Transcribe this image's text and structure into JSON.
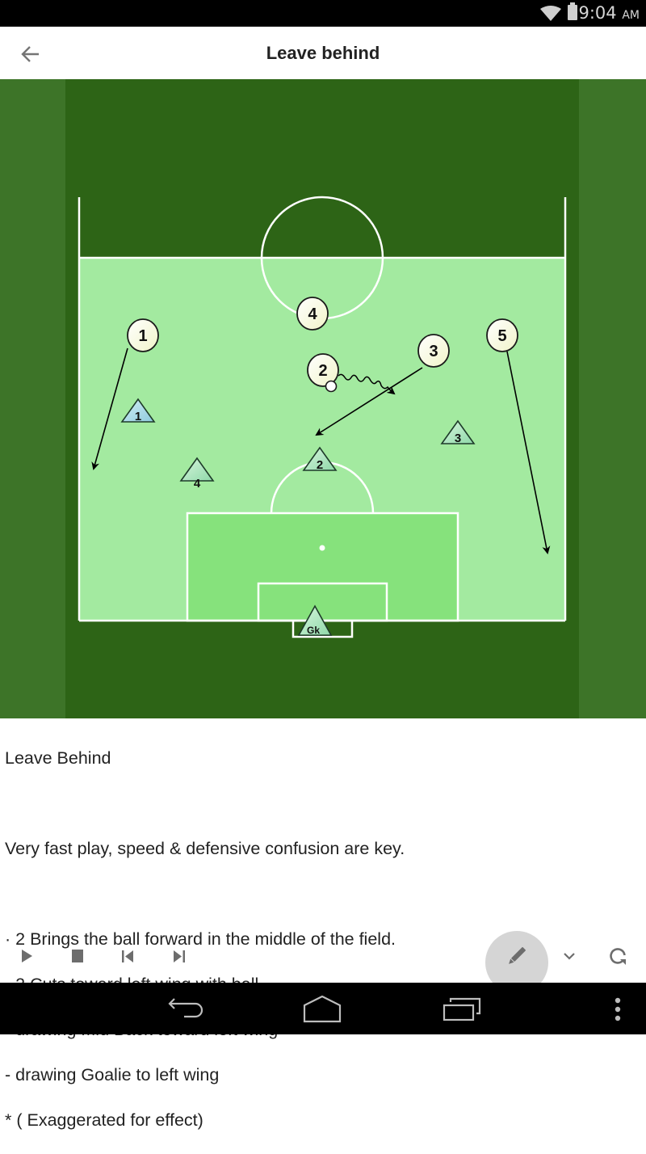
{
  "status_bar": {
    "time": "9:04",
    "ampm": "AM",
    "icons": [
      "wifi-icon",
      "battery-icon"
    ]
  },
  "app_bar": {
    "title": "Leave behind",
    "back_icon": "arrow-left-icon"
  },
  "diagram": {
    "colors": {
      "outer_grass": "#3d7428",
      "inner_grass": "#2d6416",
      "half_field": "#a3eaa0",
      "penalty_area": "#86e27c",
      "lines": "#ffffff",
      "attacker_fill": "#fdfde8",
      "defender_fill": "#b8ecc8",
      "defender1_fill": "#a8daea",
      "arrow": "#000000"
    },
    "attackers": [
      {
        "label": "1"
      },
      {
        "label": "2"
      },
      {
        "label": "3"
      },
      {
        "label": "4"
      },
      {
        "label": "5"
      }
    ],
    "defenders": [
      {
        "label": "1"
      },
      {
        "label": "2"
      },
      {
        "label": "3"
      },
      {
        "label": "4"
      },
      {
        "label": "Gk"
      }
    ]
  },
  "description": {
    "title": "Leave Behind",
    "summary": "Very fast play, speed & defensive confusion are key.",
    "steps": [
      "· 2 Brings the ball forward in the middle of the field.",
      "· 2 Cuts toward left wing with ball",
      "- drawing Mid Back toward left wing",
      "- drawing Goalie to left wing",
      "*  ( Exaggerated  for effect)"
    ]
  },
  "controls": {
    "play": "play-icon",
    "stop": "stop-icon",
    "previous": "skip-previous-icon",
    "next": "skip-next-icon",
    "edit": "pencil-icon",
    "expand": "chevron-down-icon",
    "replay": "replay-icon"
  },
  "nav_bar": {
    "back": "back-icon",
    "home": "home-icon",
    "recents": "recents-icon",
    "menu": "more-vert-icon"
  }
}
